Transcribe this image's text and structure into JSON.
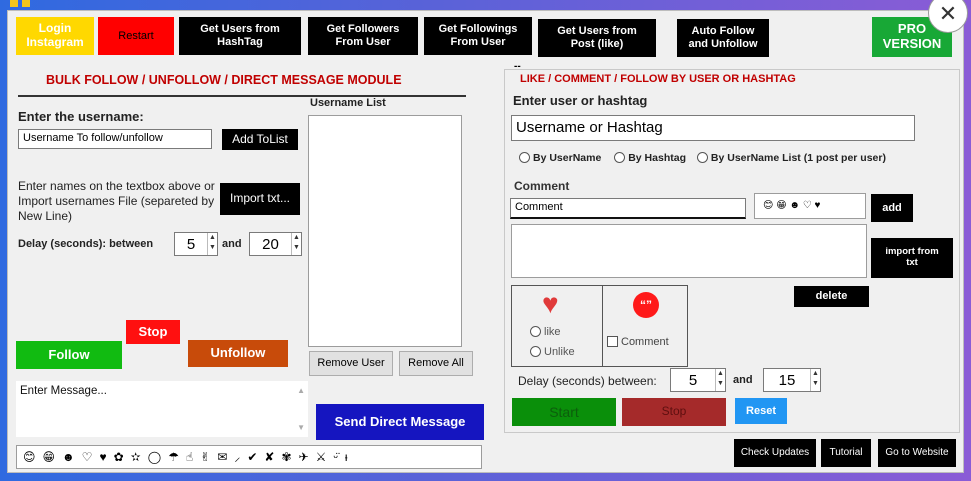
{
  "colors": {
    "login_bg": "#ffd800",
    "login_text": "#ffffff",
    "restart_bg": "#ff0000",
    "restart_text": "#000000",
    "pro_bg": "#18a836",
    "follow_bg": "#11bb11",
    "stop_bg": "#ff1010",
    "unfollow_bg": "#c84b0a",
    "send_bg": "#1515c0",
    "start_bg": "#0a8f0a",
    "stop2_bg": "#a52a2a",
    "reset_bg": "#2196f3",
    "section_title": "#c00000"
  },
  "toolbar": {
    "login": "Login Instagram",
    "restart": "Restart",
    "users_hashtag": "Get Users from HashTag",
    "followers": "Get Followers From User",
    "followings": "Get Followings From User",
    "users_post": "Get Users from Post (like)",
    "auto_follow": "Auto Follow and Unfollow",
    "pro": "PRO VERSION"
  },
  "left": {
    "title": "BULK FOLLOW / UNFOLLOW / DIRECT MESSAGE MODULE",
    "enter_username_label": "Enter the username:",
    "username_input": "Username To follow/unfollow",
    "add_to_list": "Add ToList",
    "import_help": "Enter names on the textbox above or Import usernames File (separeted by New Line)",
    "import_txt": "Import txt...",
    "delay_label": "Delay (seconds): between",
    "delay_from": "5",
    "delay_and": "and",
    "delay_to": "20",
    "username_list_label": "Username List",
    "remove_user": "Remove User",
    "remove_all": "Remove All",
    "follow": "Follow",
    "stop": "Stop",
    "unfollow": "Unfollow",
    "message_placeholder": "Enter Message...",
    "send_dm": "Send Direct Message",
    "emojis": [
      "😊",
      "😁",
      "☻",
      "♡",
      "♥",
      "✿",
      "✫",
      "◯",
      "☂",
      "☝",
      "✌",
      "✉",
      "⸝",
      "✔",
      "✘",
      "✾",
      "✈",
      "⚔",
      "ᵕ̈",
      "ᵻ"
    ]
  },
  "right": {
    "dash": "--",
    "title": "LIKE / COMMENT / FOLLOW BY USER OR HASHTAG",
    "enter_label": "Enter user or hashtag",
    "user_input": "Username or Hashtag",
    "radio_username": "By UserName",
    "radio_hashtag": "By Hashtag",
    "radio_list": "By UserName List (1 post per user)",
    "comment_label": "Comment",
    "comment_input": "Comment",
    "comment_emojis": "😊 😁 ☻ ♡ ♥",
    "add": "add",
    "import_from_txt": "import from txt",
    "delete": "delete",
    "like": "like",
    "unlike": "Unlike",
    "comment_check": "Comment",
    "delay_label": "Delay (seconds) between:",
    "delay_from": "5",
    "delay_and": "and",
    "delay_to": "15",
    "start": "Start",
    "stop": "Stop",
    "reset": "Reset"
  },
  "footer": {
    "check_updates": "Check Updates",
    "tutorial": "Tutorial",
    "website": "Go to Website"
  },
  "window": {
    "close": "✕"
  }
}
